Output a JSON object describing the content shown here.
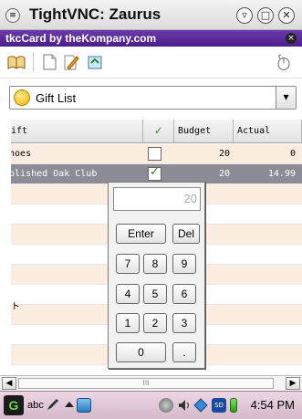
{
  "vnc_window": {
    "title": "TightVNC: Zaurus",
    "sys_icon": "menu-icon",
    "buttons": [
      {
        "name": "minimize-icon",
        "glyph": "▿"
      },
      {
        "name": "maximize-icon",
        "glyph": "□"
      },
      {
        "name": "close-icon",
        "glyph": "✕"
      }
    ]
  },
  "app": {
    "title": "tkcCard by theKompany.com",
    "close_glyph": "×"
  },
  "toolbar": {
    "icons": [
      "open-book-icon",
      "new-document-icon",
      "edit-pencil-icon",
      "import-icon",
      "mouse-icon"
    ]
  },
  "category": {
    "label": "Gift List",
    "icon": "smiley-icon",
    "arrow": "▾"
  },
  "table": {
    "columns": [
      "Gift",
      "✓",
      "Budget",
      "Actual"
    ],
    "rows": [
      {
        "gift": "Shoes",
        "checked": false,
        "budget": "20",
        "actual": "0",
        "selected": false
      },
      {
        "gift": "Polished Oak Club",
        "checked": true,
        "budget": "20",
        "actual": "14.99",
        "selected": true
      },
      {
        "gift": "",
        "checked": null,
        "budget": "",
        "actual": "",
        "selected": false
      },
      {
        "gift": "",
        "checked": null,
        "budget": "",
        "actual": "",
        "selected": false
      },
      {
        "gift": "",
        "checked": null,
        "budget": "",
        "actual": "",
        "selected": false
      },
      {
        "gift": "",
        "checked": null,
        "budget": "",
        "actual": "",
        "selected": false
      },
      {
        "gift": "",
        "checked": null,
        "budget": "",
        "actual": "",
        "selected": false
      },
      {
        "gift": "",
        "checked": null,
        "budget": "",
        "actual": "",
        "selected": false
      },
      {
        "gift": "",
        "checked": null,
        "budget": "",
        "actual": "",
        "selected": false
      },
      {
        "gift": "",
        "checked": null,
        "budget": "",
        "actual": "",
        "selected": false
      },
      {
        "gift": "",
        "checked": null,
        "budget": "",
        "actual": "",
        "selected": false
      },
      {
        "gift": "",
        "checked": null,
        "budget": "",
        "actual": "",
        "selected": false
      }
    ],
    "stray_text": "ト"
  },
  "calculator": {
    "display": "20",
    "enter_label": "Enter",
    "del_label": "Del",
    "keys": [
      "7",
      "8",
      "9",
      "4",
      "5",
      "6",
      "1",
      "2",
      "3",
      "0",
      "."
    ]
  },
  "scrollbar": {
    "left_arrow": "◀",
    "right_arrow": "▶",
    "grip": "III"
  },
  "taskbar": {
    "start_glyph": "G",
    "ime_label": "abc",
    "tray_icons": [
      "pencil-icon",
      "arrow-up-icon",
      "app-window-icon",
      "gears-icon",
      "speaker-icon",
      "network-icon",
      "sd-card-icon",
      "battery-icon"
    ],
    "clock": "4:54 PM"
  },
  "colors": {
    "app_bar": "#5a2a9a",
    "row_alt": "#fbeee0",
    "row_selected": "#8c8c96",
    "taskbar": "#e0c6d6"
  }
}
